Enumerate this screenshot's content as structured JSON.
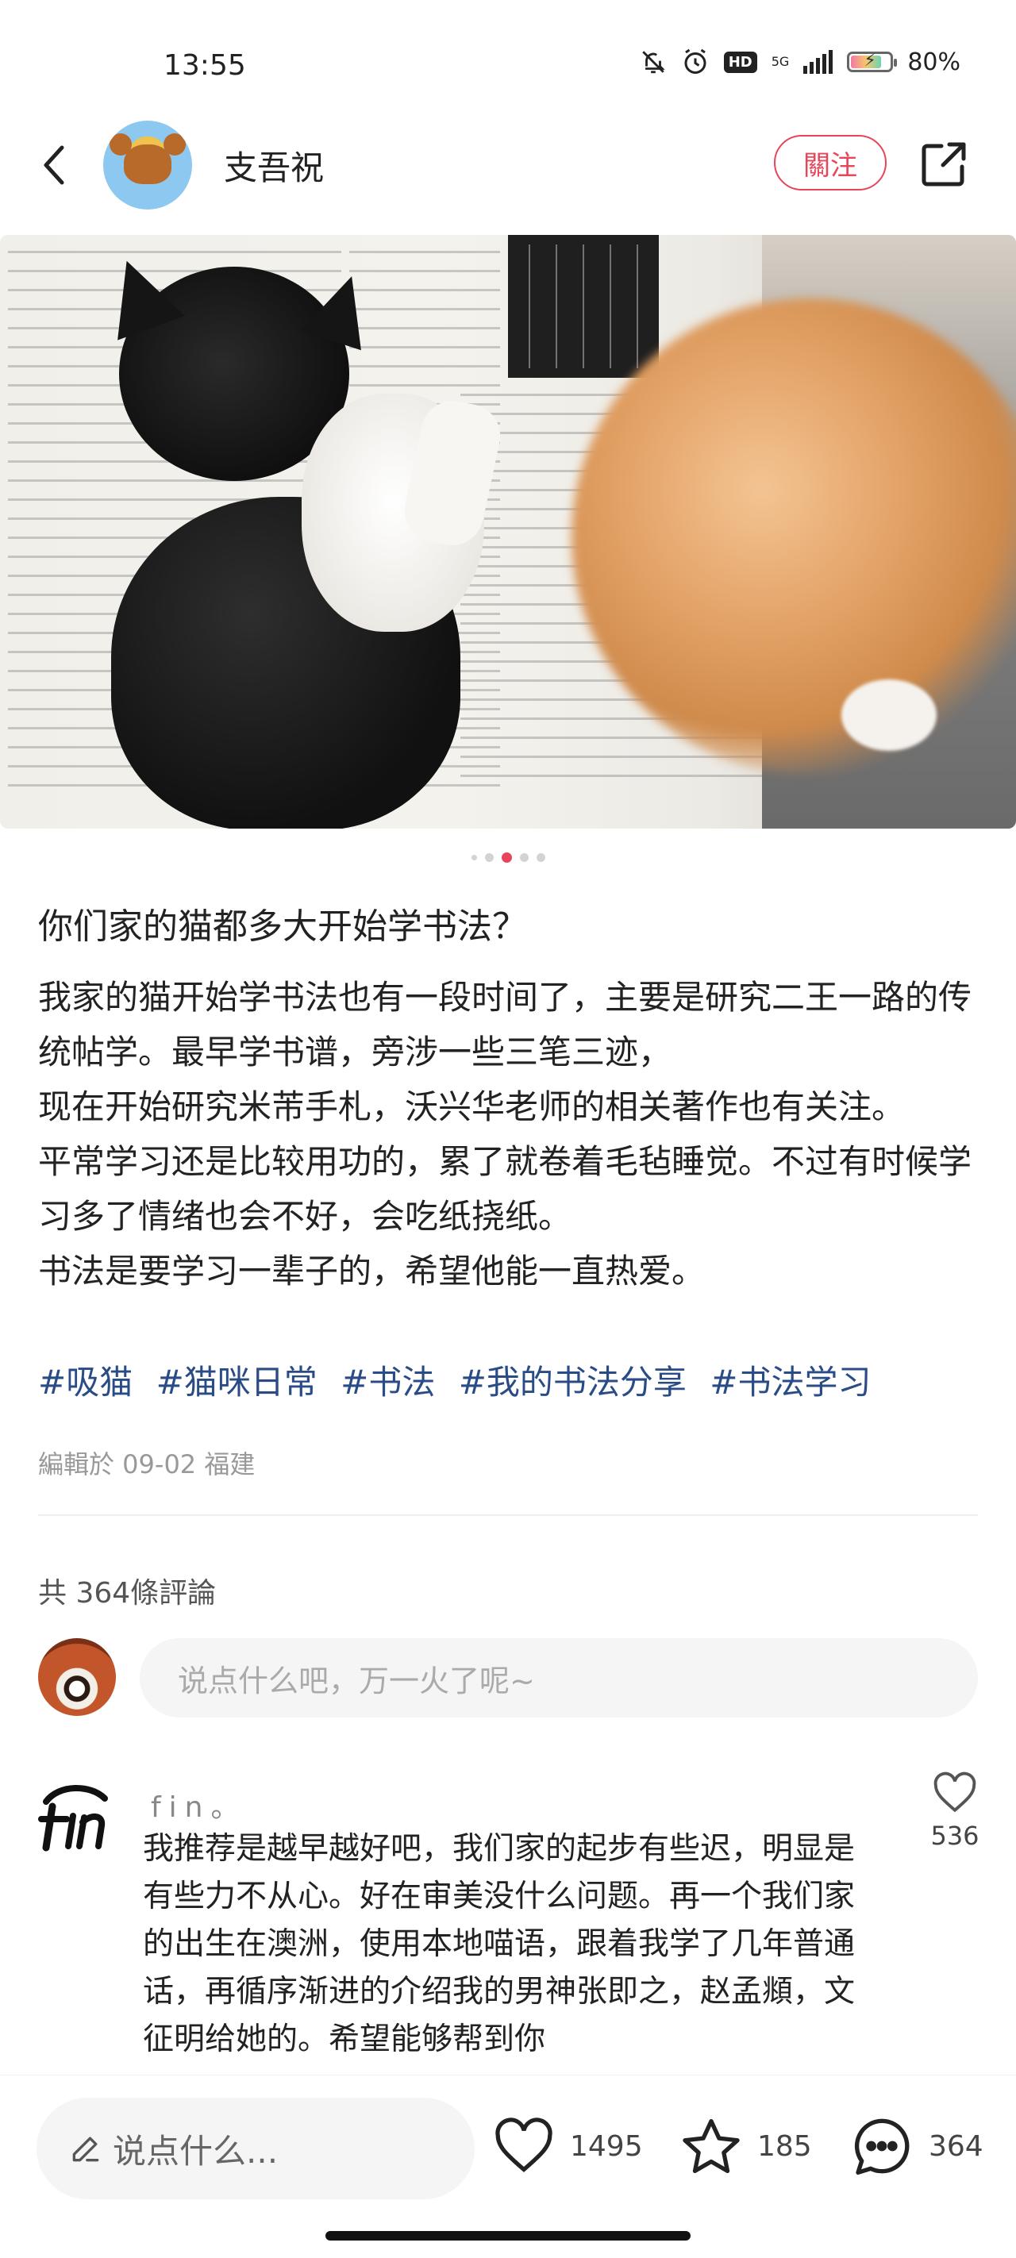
{
  "status_bar": {
    "time": "13:55",
    "network_label": "5G",
    "hd_label": "HD",
    "battery_percent": "80%",
    "battery_level": 0.8,
    "icons": [
      "mute-bell-icon",
      "alarm-icon",
      "hd-icon",
      "signal-icon",
      "battery-icon"
    ]
  },
  "header": {
    "author_name": "支吾祝",
    "follow_label": "關注",
    "icons": [
      "back-arrow-icon",
      "share-icon"
    ]
  },
  "carousel": {
    "total": 5,
    "current": 3
  },
  "post": {
    "title": "你们家的猫都多大开始学书法？",
    "body": [
      "我家的猫开始学书法也有一段时间了，主要是研究二王一路的传统帖学。最早学书谱，旁涉一些三笔三迹，",
      "现在开始研究米芾手札，沃兴华老师的相关著作也有关注。",
      "平常学习还是比较用功的，累了就卷着毛毡睡觉。不过有时候学习多了情绪也会不好，会吃纸挠纸。",
      "书法是要学习一辈子的，希望他能一直热爱。"
    ],
    "hashtags": [
      "#吸猫",
      "#猫咪日常",
      "#书法",
      "#我的书法分享",
      "#书法学习"
    ],
    "edit_meta": "編輯於 09-02 福建"
  },
  "comments_section": {
    "count_label": "共 364條評論",
    "input_placeholder": "说点什么吧，万一火了呢~",
    "comments": [
      {
        "user": "fin。",
        "text": "我推荐是越早越好吧，我们家的起步有些迟，明显是有些力不从心。好在审美没什么问题。再一个我们家的出生在澳洲，使用本地喵语，跟着我学了几年普通话，再循序渐进的介绍我的男神张即之，赵孟頫，文征明给她的。希望能够帮到你",
        "likes": "536"
      }
    ]
  },
  "bottom_bar": {
    "input_label": "说点什么...",
    "likes": "1495",
    "favorites": "185",
    "comments": "364",
    "icons": [
      "pencil-icon",
      "heart-icon",
      "star-icon",
      "comment-bubble-icon"
    ]
  },
  "colors": {
    "accent": "#e8455a",
    "hashtag": "#2a4c86",
    "muted_text": "#999999"
  }
}
